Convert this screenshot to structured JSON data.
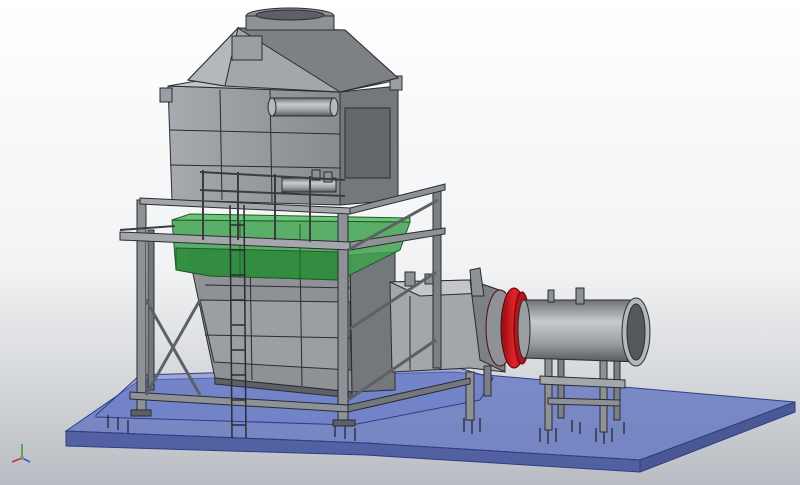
{
  "viewport": {
    "background_top": "#ffffff",
    "background_bottom": "#b9bdc3",
    "view_mode": "shaded-with-edges"
  },
  "colors": {
    "steel": "#8e9196",
    "steel_light": "#b4b7bb",
    "steel_dark": "#5d6066",
    "edge": "#2a2c30",
    "hopper": "#3fa14f",
    "hopper_edge": "#1f5a2a",
    "flange": "#d1161b",
    "foundation": "#5c70bf",
    "foundation_edge": "#2f3d86"
  },
  "model": {
    "components": [
      "roof-hood",
      "upper-casing",
      "cross-pipe",
      "hopper",
      "support-frame",
      "access-ladder",
      "handrail",
      "lower-casing",
      "outlet-duct",
      "flange-ring",
      "outlet-pipe",
      "pipe-support",
      "foundation-slab"
    ]
  },
  "triad": {
    "axes": [
      {
        "name": "x",
        "color": "#d12a2a"
      },
      {
        "name": "y",
        "color": "#2aa12a"
      },
      {
        "name": "z",
        "color": "#2a44d1"
      }
    ]
  }
}
